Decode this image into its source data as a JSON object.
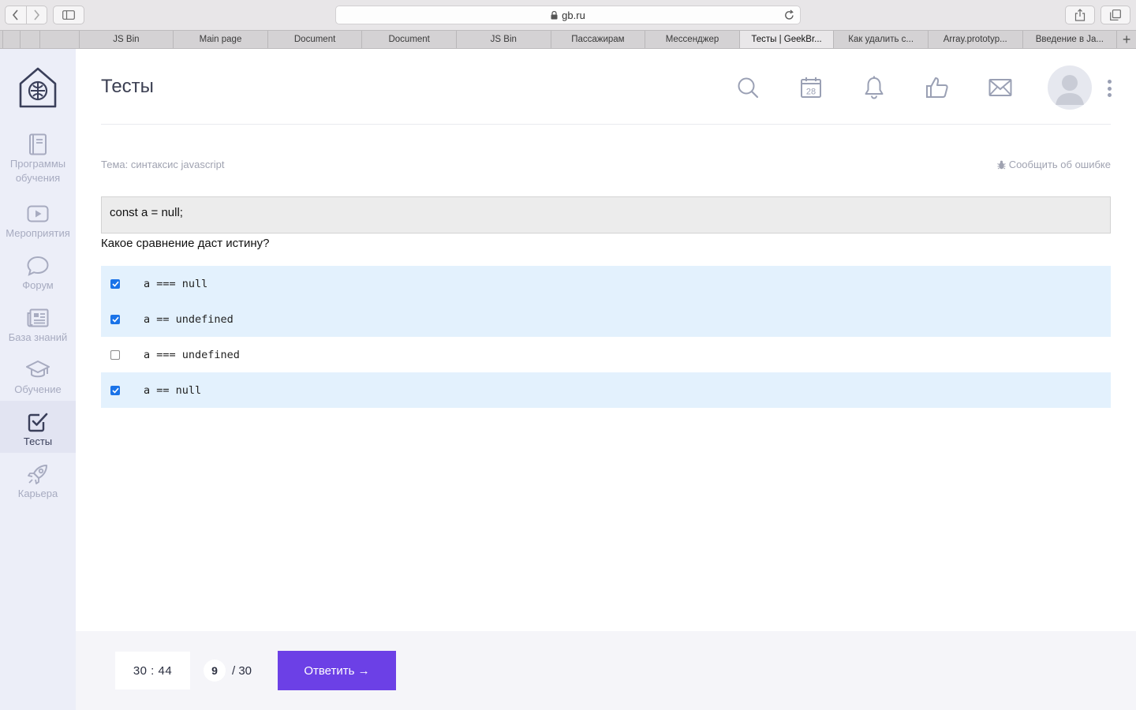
{
  "browser": {
    "url": "gb.ru",
    "tabs": [
      {
        "label": "",
        "pinned": true
      },
      {
        "label": "",
        "pinned": true
      },
      {
        "label": "",
        "pinned": true
      },
      {
        "label": "",
        "pinned": true
      },
      {
        "label": "JS Bin"
      },
      {
        "label": "Main page"
      },
      {
        "label": "Document"
      },
      {
        "label": "Document"
      },
      {
        "label": "JS Bin"
      },
      {
        "label": "Пассажирам"
      },
      {
        "label": "Мессенджер"
      },
      {
        "label": "Тесты | GeekBr...",
        "active": true
      },
      {
        "label": "Как удалить с..."
      },
      {
        "label": "Array.prototyp..."
      },
      {
        "label": "Введение в Ja..."
      }
    ],
    "add_tab": "+"
  },
  "sidebar": {
    "items": [
      {
        "label": "Программы обучения",
        "icon": "book-icon"
      },
      {
        "label": "Мероприятия",
        "icon": "play-icon"
      },
      {
        "label": "Форум",
        "icon": "chat-bubble-icon"
      },
      {
        "label": "База знаний",
        "icon": "newspaper-icon"
      },
      {
        "label": "Обучение",
        "icon": "graduation-cap-icon"
      },
      {
        "label": "Тесты",
        "icon": "checkbox-icon",
        "active": true
      },
      {
        "label": "Карьера",
        "icon": "rocket-icon"
      }
    ]
  },
  "header": {
    "title": "Тесты",
    "calendar_day": "28",
    "icons": [
      "search-icon",
      "calendar-icon",
      "bell-icon",
      "thumbs-up-icon",
      "mail-icon"
    ]
  },
  "quiz": {
    "topic": "Тема: синтаксис javascript",
    "report_label": "Сообщить об ошибке",
    "code": "const a = null;",
    "question": "Какое сравнение даст истину?",
    "answers": [
      {
        "text": "a === null",
        "checked": true
      },
      {
        "text": "a == undefined",
        "checked": true
      },
      {
        "text": "a === undefined",
        "checked": false
      },
      {
        "text": "a == null",
        "checked": true
      }
    ]
  },
  "footer": {
    "timer": "30 : 44",
    "current_question": "9",
    "total_questions": "/ 30",
    "submit_label": "Ответить →"
  },
  "colors": {
    "accent": "#6c40e6",
    "sidebar_bg": "#eceef8",
    "checked_row": "#e3f1fd",
    "checkbox": "#1a73e8"
  }
}
